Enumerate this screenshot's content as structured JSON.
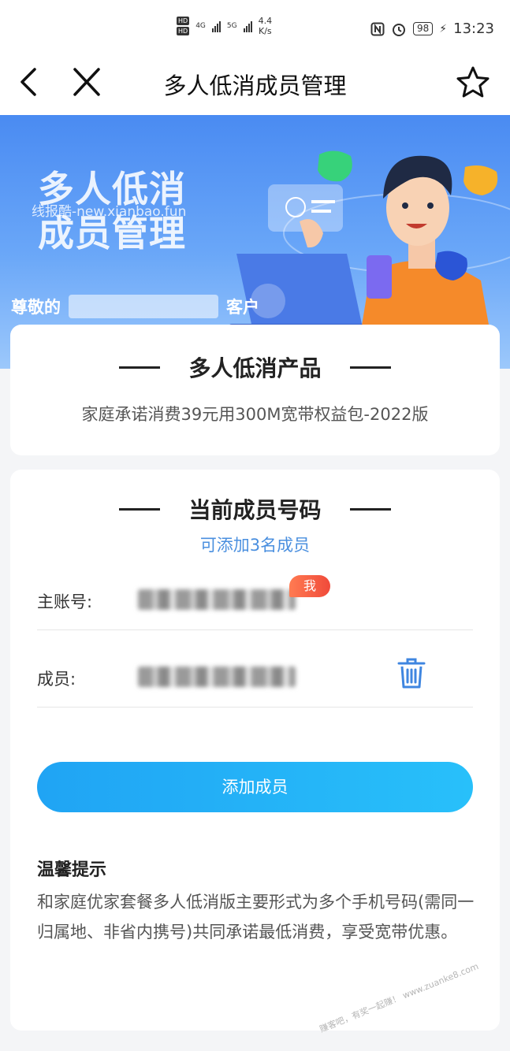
{
  "status_bar": {
    "hd1": "HD",
    "hd2": "HD",
    "net1": "4G",
    "net2": "5G",
    "speed_value": "4.4",
    "speed_unit": "K/s",
    "battery": "98",
    "time": "13:23"
  },
  "nav": {
    "title": "多人低消成员管理"
  },
  "banner": {
    "title_line1": "多人低消",
    "title_line2": "成员管理",
    "watermark": "线报酷-new.xianbao.fun",
    "greeting_prefix": "尊敬的",
    "greeting_suffix": "客户"
  },
  "product": {
    "heading": "多人低消产品",
    "description": "家庭承诺消费39元用300M宽带权益包-2022版"
  },
  "members": {
    "heading": "当前成员号码",
    "subheading": "可添加3名成员",
    "main_label": "主账号:",
    "me_badge": "我",
    "member_label": "成员:",
    "add_button": "添加成员"
  },
  "tips": {
    "title": "温馨提示",
    "text": "和家庭优家套餐多人低消版主要形式为多个手机号码(需同一归属地、非省内携号)共同承诺最低消费，享受宽带优惠。"
  },
  "corner_watermark": "赚客吧，有奖一起赚！ www.zuanke8.com",
  "colors": {
    "accent_blue": "#4a8fdf",
    "button_start": "#20a4f4",
    "button_end": "#28c0fa",
    "badge_red": "#f04a3a"
  }
}
